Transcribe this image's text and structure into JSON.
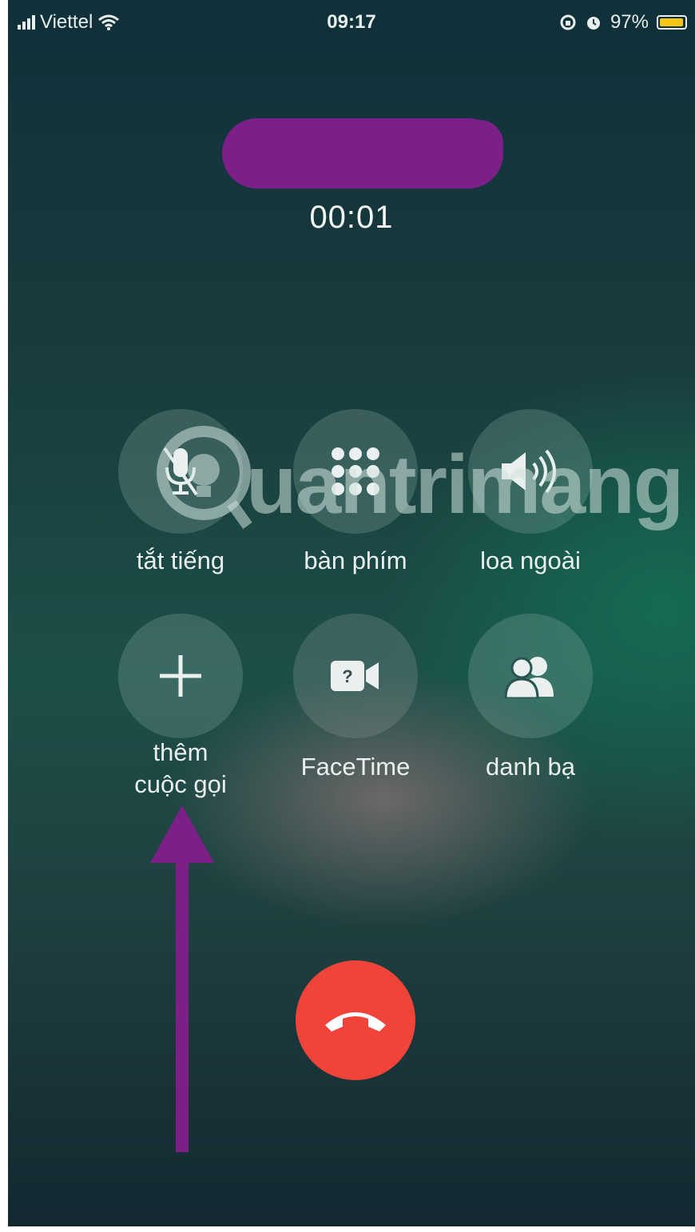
{
  "status_bar": {
    "carrier": "Viettel",
    "time": "09:17",
    "battery_percent": "97%",
    "battery_level": 0.97
  },
  "call": {
    "timer": "00:01"
  },
  "controls": {
    "mute": "tắt tiếng",
    "keypad": "bàn phím",
    "speaker": "loa ngoài",
    "add_call_line1": "thêm",
    "add_call_line2": "cuộc gọi",
    "facetime": "FaceTime",
    "contacts": "danh bạ"
  },
  "watermark": {
    "text": "uantrimang"
  },
  "colors": {
    "end_call": "#f0443a",
    "redaction": "#7d1f88",
    "arrow": "#7d1f88",
    "battery": "#f5c518"
  }
}
